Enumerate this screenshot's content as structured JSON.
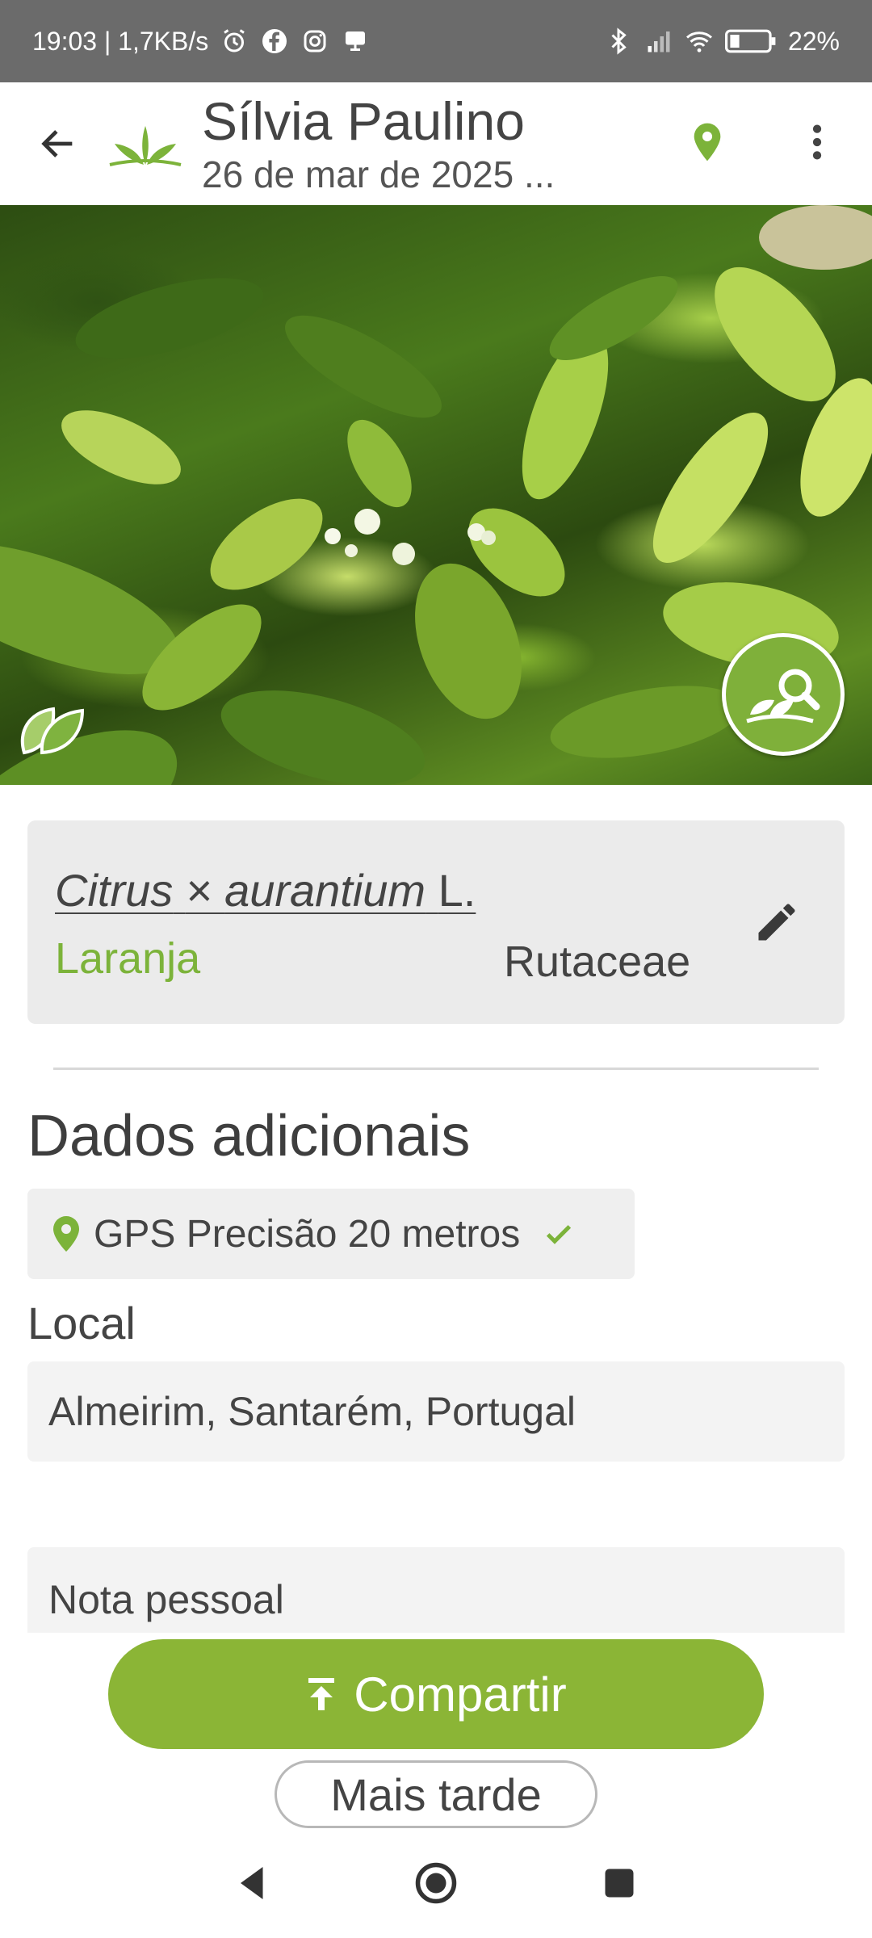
{
  "status_bar": {
    "left_text": "19:03 | 1,7KB/s",
    "battery": "22%",
    "icons": [
      "alarm-icon",
      "facebook-icon",
      "instagram-icon",
      "cast-icon",
      "bluetooth-icon",
      "signal-icon",
      "wifi-icon",
      "battery-icon"
    ]
  },
  "header": {
    "title": "Sílvia Paulino",
    "subtitle": "26 de mar de 2025 ..."
  },
  "species": {
    "genus": "Citrus",
    "hybrid_sign": "×",
    "epithet": "aurantium",
    "author": "L.",
    "common_name": "Laranja",
    "family": "Rutaceae"
  },
  "additional": {
    "section_title": "Dados adicionais",
    "gps_text": "GPS Precisão 20 metros",
    "location_label": "Local",
    "location_value": "Almeirim, Santarém, Portugal",
    "note_placeholder": "Nota pessoal"
  },
  "actions": {
    "share_label": "Compartir",
    "later_label": "Mais tarde"
  },
  "colors": {
    "accent_green": "#8bb536",
    "name_green": "#7cb33a",
    "status_bar": "#6b6b6b"
  }
}
